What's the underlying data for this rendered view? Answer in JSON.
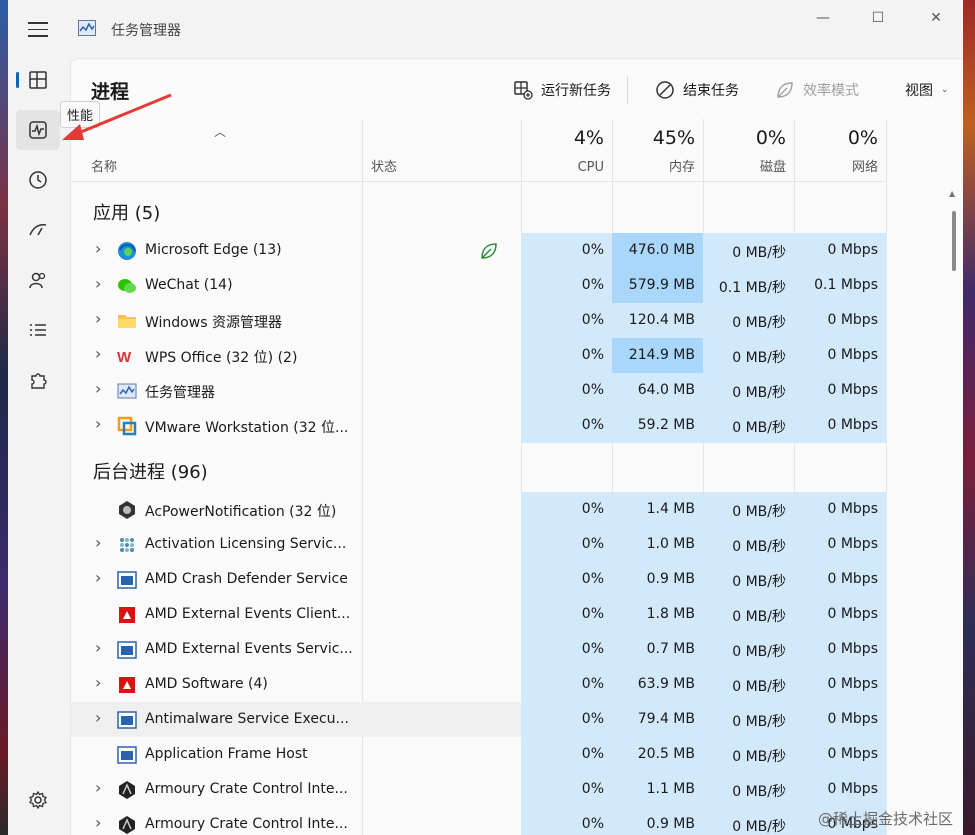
{
  "window": {
    "title": "任务管理器",
    "controls": {
      "minimize": "—",
      "maximize": "☐",
      "close": "✕"
    }
  },
  "tooltip": "性能",
  "page_title": "进程",
  "toolbar": {
    "run_new_task": "运行新任务",
    "end_task": "结束任务",
    "efficiency_mode": "效率模式",
    "view": "视图"
  },
  "columns": {
    "name": "名称",
    "status": "状态",
    "cpu": {
      "pct": "4%",
      "label": "CPU"
    },
    "memory": {
      "pct": "45%",
      "label": "内存"
    },
    "disk": {
      "pct": "0%",
      "label": "磁盘"
    },
    "network": {
      "pct": "0%",
      "label": "网络"
    }
  },
  "groups": {
    "apps": "应用 (5)",
    "background": "后台进程 (96)"
  },
  "apps": [
    {
      "name": "Microsoft Edge (13)",
      "icon": "edge-icon",
      "cpu": "0%",
      "mem": "476.0 MB",
      "disk": "0 MB/秒",
      "net": "0 Mbps",
      "expandable": true,
      "efficiency": true,
      "mem_high": true
    },
    {
      "name": "WeChat (14)",
      "icon": "wechat-icon",
      "cpu": "0%",
      "mem": "579.9 MB",
      "disk": "0.1 MB/秒",
      "net": "0.1 Mbps",
      "expandable": true,
      "mem_high": true
    },
    {
      "name": "Windows 资源管理器",
      "icon": "folder-icon",
      "cpu": "0%",
      "mem": "120.4 MB",
      "disk": "0 MB/秒",
      "net": "0 Mbps",
      "expandable": true
    },
    {
      "name": "WPS Office (32 位) (2)",
      "icon": "wps-icon",
      "cpu": "0%",
      "mem": "214.9 MB",
      "disk": "0 MB/秒",
      "net": "0 Mbps",
      "expandable": true,
      "mem_high": true
    },
    {
      "name": "任务管理器",
      "icon": "task-manager-icon",
      "cpu": "0%",
      "mem": "64.0 MB",
      "disk": "0 MB/秒",
      "net": "0 Mbps",
      "expandable": true
    },
    {
      "name": "VMware Workstation (32 位...",
      "icon": "vmware-icon",
      "cpu": "0%",
      "mem": "59.2 MB",
      "disk": "0 MB/秒",
      "net": "0 Mbps",
      "expandable": true
    }
  ],
  "background": [
    {
      "name": "AcPowerNotification (32 位)",
      "icon": "power-icon",
      "cpu": "0%",
      "mem": "1.4 MB",
      "disk": "0 MB/秒",
      "net": "0 Mbps",
      "expandable": false
    },
    {
      "name": "Activation Licensing Servic...",
      "icon": "licensing-icon",
      "cpu": "0%",
      "mem": "1.0 MB",
      "disk": "0 MB/秒",
      "net": "0 Mbps",
      "expandable": true
    },
    {
      "name": "AMD Crash Defender Service",
      "icon": "service-icon",
      "cpu": "0%",
      "mem": "0.9 MB",
      "disk": "0 MB/秒",
      "net": "0 Mbps",
      "expandable": true
    },
    {
      "name": "AMD External Events Client...",
      "icon": "amd-icon",
      "cpu": "0%",
      "mem": "1.8 MB",
      "disk": "0 MB/秒",
      "net": "0 Mbps",
      "expandable": false
    },
    {
      "name": "AMD External Events Servic...",
      "icon": "service-icon",
      "cpu": "0%",
      "mem": "0.7 MB",
      "disk": "0 MB/秒",
      "net": "0 Mbps",
      "expandable": true
    },
    {
      "name": "AMD Software (4)",
      "icon": "amd-icon",
      "cpu": "0%",
      "mem": "63.9 MB",
      "disk": "0 MB/秒",
      "net": "0 Mbps",
      "expandable": true
    },
    {
      "name": "Antimalware Service Execu...",
      "icon": "service-icon",
      "cpu": "0%",
      "mem": "79.4 MB",
      "disk": "0 MB/秒",
      "net": "0 Mbps",
      "expandable": true,
      "hover": true
    },
    {
      "name": "Application Frame Host",
      "icon": "service-icon",
      "cpu": "0%",
      "mem": "20.5 MB",
      "disk": "0 MB/秒",
      "net": "0 Mbps",
      "expandable": false
    },
    {
      "name": "Armoury Crate Control Inte...",
      "icon": "armoury-icon",
      "cpu": "0%",
      "mem": "1.1 MB",
      "disk": "0 MB/秒",
      "net": "0 Mbps",
      "expandable": true
    },
    {
      "name": "Armoury Crate Control Inte...",
      "icon": "armoury-icon",
      "cpu": "0%",
      "mem": "0.9 MB",
      "disk": "0 MB/秒",
      "net": "0 Mbps",
      "expandable": true
    }
  ],
  "watermark": "@稀土掘金技术社区",
  "colors": {
    "heat_light": "#d2e8fb",
    "heat_dark": "#a9d6fb",
    "accent": "#0067c0",
    "arrow": "#e53935"
  }
}
